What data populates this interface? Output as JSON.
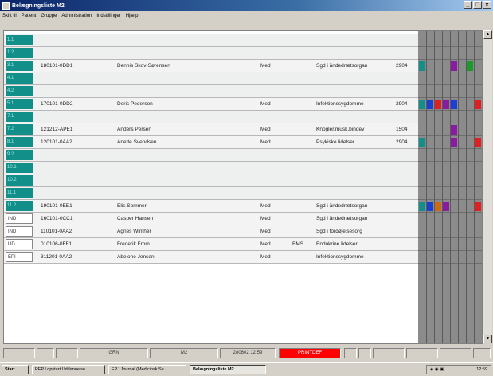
{
  "window": {
    "title": "Belægningsliste M2",
    "controls": [
      "_",
      "□",
      "x"
    ]
  },
  "menu": [
    "Skift til",
    "Patient",
    "Gruppe",
    "Administration",
    "Indstillinger",
    "Hjælp"
  ],
  "rows": [
    {
      "label": "1.1",
      "style": "teal"
    },
    {
      "label": "1.2",
      "style": "teal"
    },
    {
      "label": "3.1",
      "style": "teal",
      "cpr": "180101-0DD1",
      "name": "Dennis Skov-Sørensen",
      "spec": "Med",
      "extra": "",
      "diagnosis": "Sgd i åndedrætsorgan",
      "code": "2904"
    },
    {
      "label": "4.1",
      "style": "teal"
    },
    {
      "label": "4.2",
      "style": "teal"
    },
    {
      "label": "5.1",
      "style": "teal",
      "cpr": "170101-0DD2",
      "name": "Doris Pedersen",
      "spec": "Med",
      "extra": "",
      "diagnosis": "Infektionssygdomme",
      "code": "2904"
    },
    {
      "label": "7.1",
      "style": "teal"
    },
    {
      "label": "7.2",
      "style": "teal",
      "cpr": "121212-APE1",
      "name": "Anders Persen",
      "spec": "Med",
      "extra": "",
      "diagnosis": "Knogler,musk,bindev",
      "code": "1504"
    },
    {
      "label": "8.1",
      "style": "teal",
      "cpr": "120101-0AA2",
      "name": "Anette Svendsen",
      "spec": "Med",
      "extra": "",
      "diagnosis": "Psykiske lidelser",
      "code": "2904"
    },
    {
      "label": "9.2",
      "style": "teal"
    },
    {
      "label": "10.1",
      "style": "teal"
    },
    {
      "label": "10.2",
      "style": "teal"
    },
    {
      "label": "11.1",
      "style": "teal"
    },
    {
      "label": "11.2",
      "style": "teal",
      "cpr": "190101-0EE1",
      "name": "Elis Sommer",
      "spec": "Med",
      "extra": "",
      "diagnosis": "Sgd i åndedrætsorgan",
      "code": ""
    },
    {
      "label": "IND",
      "style": "white",
      "cpr": "160101-0CC1",
      "name": "Casper Hansen",
      "spec": "Med",
      "extra": "",
      "diagnosis": "Sgd i åndedrætsorgan",
      "code": ""
    },
    {
      "label": "IND",
      "style": "white",
      "cpr": "110101-0AA2",
      "name": "Agnes Winther",
      "spec": "Med",
      "extra": "",
      "diagnosis": "Sgd i fordøjelsesorg",
      "code": ""
    },
    {
      "label": "UD",
      "style": "white",
      "cpr": "010106-0FF1",
      "name": "Frederik From",
      "spec": "Med",
      "extra": "BMS",
      "diagnosis": "Endokrine lidelser",
      "code": ""
    },
    {
      "label": "EPI",
      "style": "white",
      "cpr": "311201-0AA2",
      "name": "Abelone Jensen",
      "spec": "Med",
      "extra": "",
      "diagnosis": "Infektionssygdomme",
      "code": ""
    }
  ],
  "status": {
    "unit": "GRN",
    "ward": "M2",
    "datetime": "280602 12:59",
    "alert": "PRINTDEF",
    "alert_color": "#ff0000"
  },
  "taskbar": {
    "start": "Start",
    "items": [
      "PEPJ opstart Uddannelse",
      "EPJ Journal (Medicinsk Se...",
      "Belægningsliste M2"
    ],
    "clock": "12:59"
  },
  "colors": {
    "teal": "#138f8a",
    "blue": "#1a3fd6",
    "red": "#e02020",
    "purple": "#8a1aa0",
    "green": "#1a9a2a",
    "orange": "#cc6a10"
  }
}
